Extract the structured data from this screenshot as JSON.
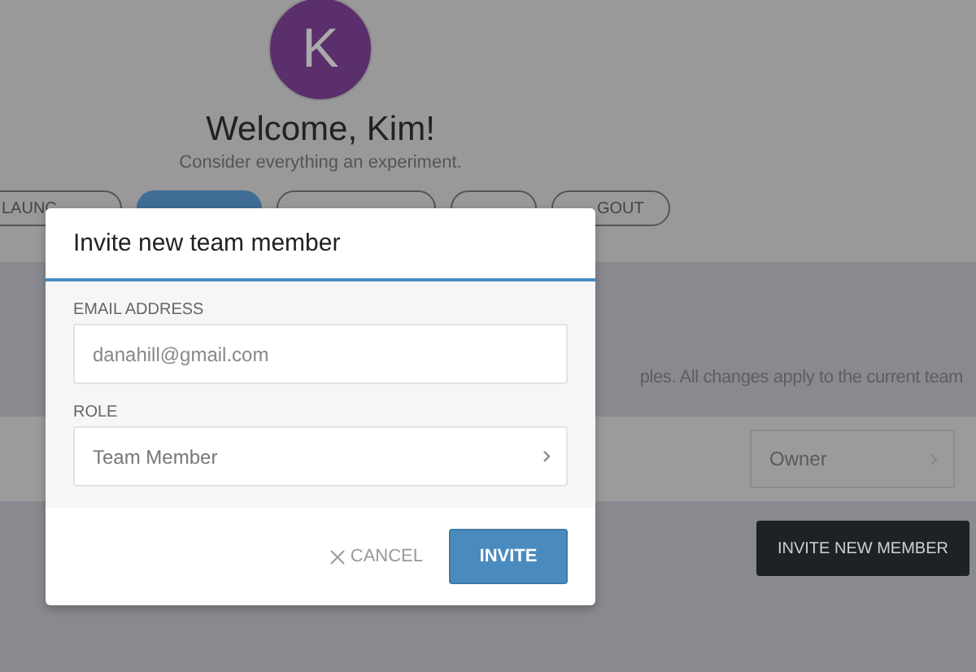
{
  "profile": {
    "avatar_letter": "K",
    "greeting": "Welcome, Kim!",
    "tagline": "Consider everything an experiment."
  },
  "nav_buttons": [
    {
      "label": "LAUNC",
      "selected": false
    },
    {
      "selected": true
    },
    {
      "selected": false
    },
    {
      "selected": false
    },
    {
      "label": "GOUT",
      "selected": false
    }
  ],
  "team_settings": {
    "description": "ples. All changes apply to the current team",
    "member_role": "Owner",
    "invite_button": "INVITE NEW MEMBER"
  },
  "modal": {
    "title": "Invite new team member",
    "fields": [
      {
        "kind": "text",
        "label": "EMAIL ADDRESS",
        "placeholder": "danahill@gmail.com"
      },
      {
        "kind": "select",
        "label": "ROLE",
        "value": "Team Member"
      }
    ],
    "buttons": [
      {
        "kind": "cancel",
        "label": "CANCEL"
      },
      {
        "kind": "primary",
        "label": "INVITE"
      }
    ]
  }
}
